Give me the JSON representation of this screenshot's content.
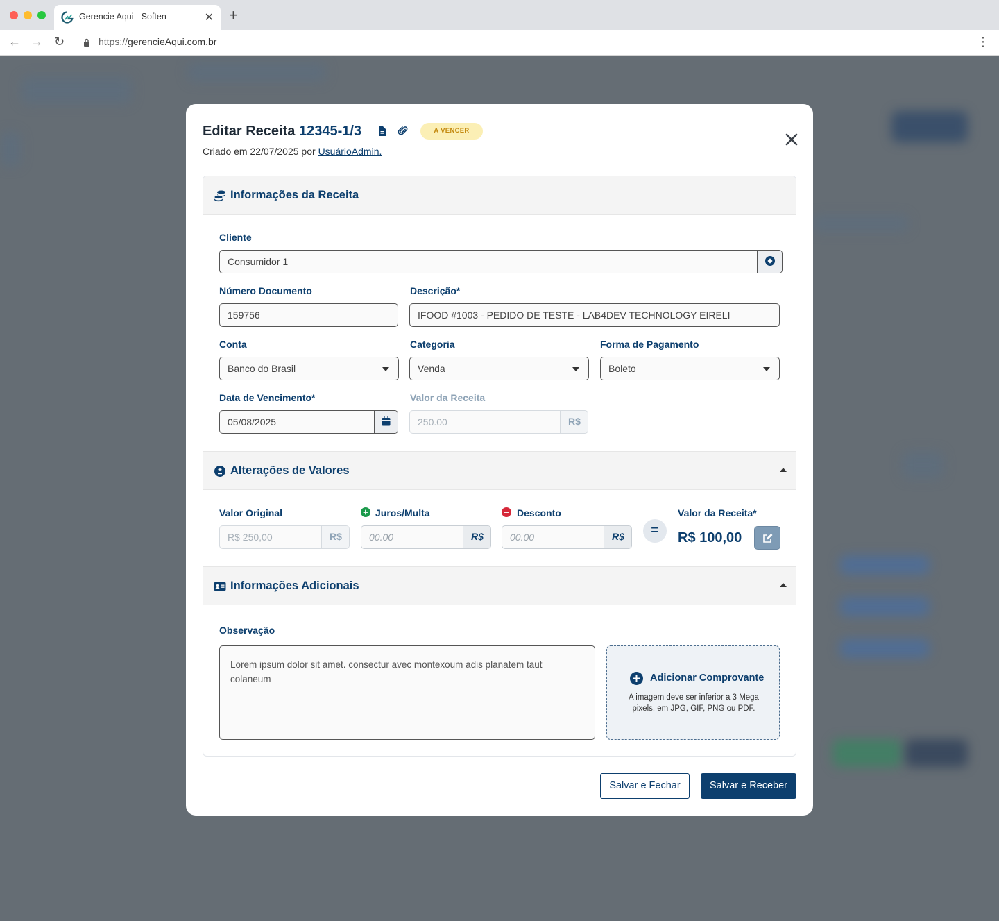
{
  "browser": {
    "tab_title": "Gerencie Aqui - Soften",
    "url_prefix": "https://",
    "url_host": "gerencieAqui.com.br"
  },
  "modal": {
    "title": "Editar Receita",
    "code": "12345-1/3",
    "status": "A VENCER",
    "subtitle_prefix": "Criado em 22/07/2025 por",
    "author": "UsuárioAdmin."
  },
  "section_info": {
    "title": "Informações da Receita",
    "cliente_label": "Cliente",
    "cliente_value": "Consumidor 1",
    "numero_label": "Número Documento",
    "numero_value": "159756",
    "descricao_label": "Descrição*",
    "descricao_value": "IFOOD #1003 - PEDIDO DE TESTE - LAB4DEV TECHNOLOGY EIRELI",
    "conta_label": "Conta",
    "conta_value": "Banco do Brasil",
    "categoria_label": "Categoria",
    "categoria_value": "Venda",
    "forma_label": "Forma de Pagamento",
    "forma_value": "Boleto",
    "vencimento_label": "Data de Vencimento*",
    "vencimento_value": "05/08/2025",
    "valor_label": "Valor da Receita",
    "valor_value": "250.00",
    "currency": "R$"
  },
  "section_valores": {
    "title": "Alterações de Valores",
    "original_label": "Valor Original",
    "original_value": "R$ 250,00",
    "juros_label": "Juros/Multa",
    "juros_placeholder": "00.00",
    "desconto_label": "Desconto",
    "desconto_placeholder": "00.00",
    "equals": "=",
    "total_label": "Valor da Receita*",
    "total_value": "R$ 100,00",
    "currency": "R$"
  },
  "section_adicionais": {
    "title": "Informações Adicionais",
    "observacao_label": "Observação",
    "observacao_value": "Lorem ipsum dolor sit amet. consectur avec montexoum adis planatem taut colaneum",
    "upload_title": "Adicionar Comprovante",
    "upload_help": "A imagem deve ser inferior a 3 Mega pixels, em JPG, GIF, PNG ou PDF."
  },
  "footer": {
    "save_close": "Salvar e Fechar",
    "save_receive": "Salvar e Receber"
  },
  "colors": {
    "primary": "#0d3f6e",
    "badge_bg": "#fbefb5",
    "badge_text": "#c48a10",
    "plus_green": "#1b9a4b",
    "minus_red": "#d62839"
  }
}
